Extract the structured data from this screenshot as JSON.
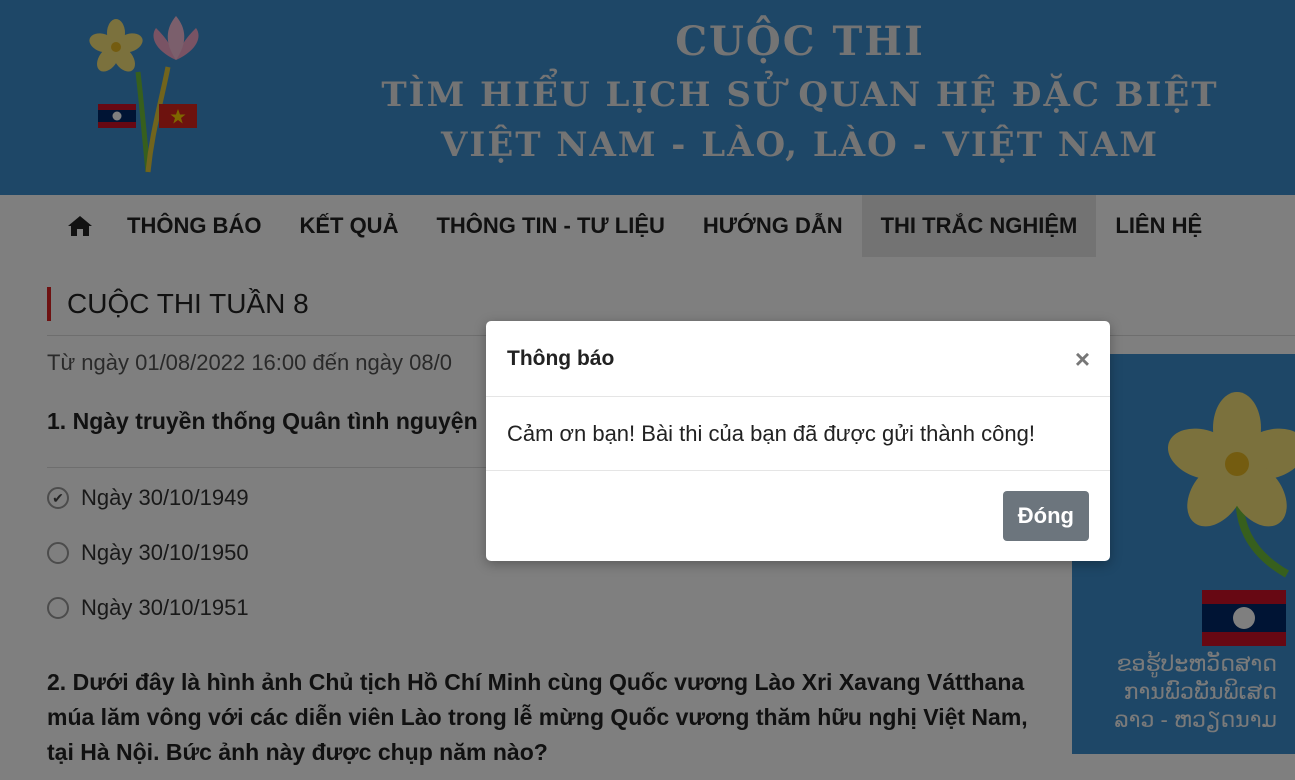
{
  "banner": {
    "line1": "CUỘC THI",
    "line2": "TÌM HIỂU LỊCH SỬ QUAN HỆ ĐẶC BIỆT",
    "line3": "VIỆT NAM - LÀO, LÀO - VIỆT NAM"
  },
  "nav": {
    "items": [
      {
        "label": "THÔNG BÁO"
      },
      {
        "label": "KẾT QUẢ"
      },
      {
        "label": "THÔNG TIN - TƯ LIỆU"
      },
      {
        "label": "HƯỚNG DẪN"
      },
      {
        "label": "THI TRẮC NGHIỆM"
      },
      {
        "label": "LIÊN HỆ"
      }
    ],
    "active": "THI TRẮC NGHIỆM"
  },
  "page": {
    "title": "CUỘC THI TUẦN 8",
    "date_range": "Từ ngày 01/08/2022 16:00 đến ngày 08/0"
  },
  "questions": [
    {
      "number": "1.",
      "text": "Ngày truyền thống Quân tình nguyện",
      "options": [
        {
          "label": "Ngày 30/10/1949",
          "checked": true
        },
        {
          "label": "Ngày 30/10/1950",
          "checked": false
        },
        {
          "label": "Ngày 30/10/1951",
          "checked": false
        }
      ]
    },
    {
      "number": "2.",
      "text": "Dưới đây là hình ảnh Chủ tịch Hồ Chí Minh cùng Quốc vương Lào Xri Xavang Vátthana múa lăm vông với các diễn viên Lào trong lễ mừng Quốc vương thăm hữu nghị Việt Nam, tại Hà Nội. Bức ảnh này được chụp năm nào?"
    }
  ],
  "side_ad": {
    "lao_lines": [
      "ຂອຮູ້ປະຫວັດສາດ",
      "ການພົວພັນພິເສດ",
      "ລາວ - ຫວຽດນາມ"
    ]
  },
  "modal": {
    "title": "Thông báo",
    "close_symbol": "×",
    "message": "Cảm ơn bạn! Bài thi của bạn đã được gửi thành công!",
    "button_label": "Đóng"
  },
  "colors": {
    "banner": "#3d8fcf",
    "accent_rule": "#dd2222",
    "button": "#6c757d"
  }
}
